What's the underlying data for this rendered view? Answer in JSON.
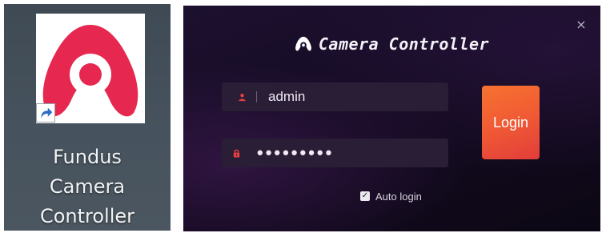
{
  "desktop_shortcut": {
    "label_lines": [
      "Fundus",
      "Camera",
      "Controller"
    ],
    "icon": "fundus-camera-app-logo",
    "overlay_icon": "shortcut-arrow-icon",
    "logo_color": "#e62850"
  },
  "login_dialog": {
    "title": "Camera Controller",
    "title_icon": "camera-controller-logo-icon",
    "close_glyph": "×",
    "username": {
      "icon": "user-icon",
      "value": "admin"
    },
    "password": {
      "icon": "lock-icon",
      "value": "•••••••••"
    },
    "login_button": "Login",
    "auto_login": {
      "label": "Auto login",
      "checked": true,
      "check_glyph": "✓"
    },
    "colors": {
      "background": "#140b22",
      "field": "#2a1d36",
      "accent": "#f05a34",
      "icon_red": "#e8403f"
    }
  }
}
